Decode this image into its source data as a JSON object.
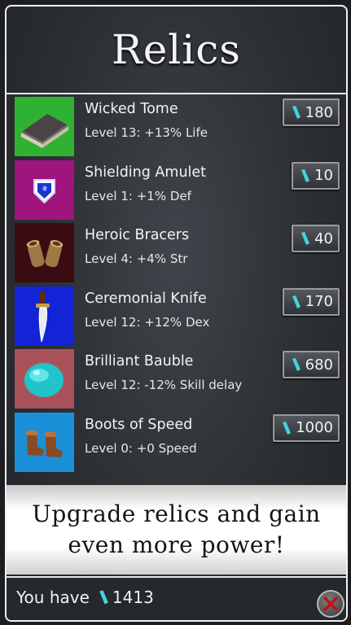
{
  "title": "Relics",
  "relics": [
    {
      "name": "Wicked Tome",
      "desc": "Level 13: +13% Life",
      "price": "180",
      "bg": "#2fb233",
      "icon": "book-icon"
    },
    {
      "name": "Shielding Amulet",
      "desc": "Level 1: +1% Def",
      "price": "10",
      "bg": "#a0147e",
      "icon": "amulet-icon"
    },
    {
      "name": "Heroic Bracers",
      "desc": "Level 4: +4% Str",
      "price": "40",
      "bg": "#3a0c12",
      "icon": "bracers-icon"
    },
    {
      "name": "Ceremonial Knife",
      "desc": "Level 12: +12% Dex",
      "price": "170",
      "bg": "#1324d6",
      "icon": "knife-icon"
    },
    {
      "name": "Brilliant Bauble",
      "desc": "Level 12: -12% Skill delay",
      "price": "680",
      "bg": "#a9525a",
      "icon": "bauble-icon"
    },
    {
      "name": "Boots of Speed",
      "desc": "Level 0: +0 Speed",
      "price": "1000",
      "bg": "#1b8fd8",
      "icon": "boots-icon"
    }
  ],
  "banner": {
    "line1": "Upgrade relics and gain",
    "line2": "even more power!"
  },
  "footer": {
    "label": "You have",
    "amount": "1413"
  },
  "colors": {
    "gem": "#3fd6e0",
    "close_x": "#c0111b"
  }
}
